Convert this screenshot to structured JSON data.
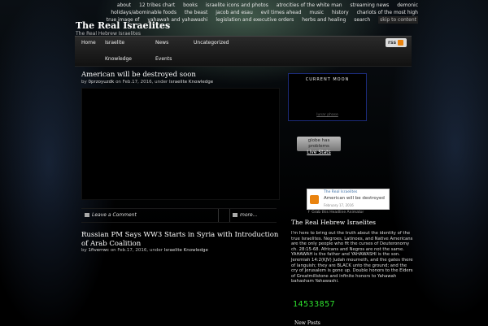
{
  "top_nav": [
    "about",
    "12 tribes chart",
    "books",
    "israelite icons and photos",
    "atrocities of the white man",
    "streaming news",
    "demonic",
    "holidays/abominable foods",
    "the beast",
    "jacob and esau",
    "evil times ahead",
    "music",
    "history",
    "chariots of the most high",
    "true image of",
    "yahawah and yahawashi",
    "legislation and executive orders",
    "herbs and healing",
    "search",
    "skip to content"
  ],
  "site": {
    "title": "The Real Israelites",
    "description": "The Real Hebrew Israelites"
  },
  "menu": [
    "Home",
    "Israelite",
    "News",
    "Uncategorized",
    "Knowledge",
    "Events"
  ],
  "rss_label": "rss",
  "posts": [
    {
      "title": "American will be destroyed soon",
      "by": "by",
      "author": "0przoyuzdk",
      "on": "on",
      "date": "Feb.17, 2016,",
      "under": "under",
      "category": "Israelite Knowledge"
    },
    {
      "title": "Russian PM Says  WW3 Starts in  Syria with Introduction of Arab Coalition",
      "by": "by",
      "author": "1fiverrwc",
      "on": "on",
      "date": "Feb.17, 2016,",
      "under": "under",
      "category": "Israelite Knowledge"
    }
  ],
  "post_actions": {
    "comment": "Leave a Comment",
    "more": "more..."
  },
  "sidebar": {
    "moon_title": "CURRENT MOON",
    "moon_link": "lunar phase",
    "globe_text": "globe has problems",
    "globe_link": "Live Stats",
    "feed_name": "The Real Israelites",
    "feed_headline": "American will be destroyed",
    "feed_date": "February 17, 2016",
    "grab_text": "↑ Grab this Headline Animator",
    "widget_title": "The Real Hebrew Israelites",
    "widget_text": "I'm here to bring out the truth about the identity of the true Israelites. Negroes, Latinoes, and Native Americans are the only people who fit the curses of Deuteronomy ch. 28:15-68. Africans and Negros are not the same. YAHAWAH is the father and YAHAWASHI is the son. Jeremiah 14:2(KJV) Judah mourneth, and the gates there of languish; they are BLACK unto the ground; and the cry of Jerusalem is gone up. Double honors to the Elders of Greatmillstone and infinite honors to Yahawah bahasham Yahawashi.",
    "counter": "14533857",
    "new_posts": "New Posts"
  },
  "colors": {
    "accent_link": "#3a6ea5",
    "counter_green": "#2ee02e",
    "rss_orange": "#e9830f"
  }
}
